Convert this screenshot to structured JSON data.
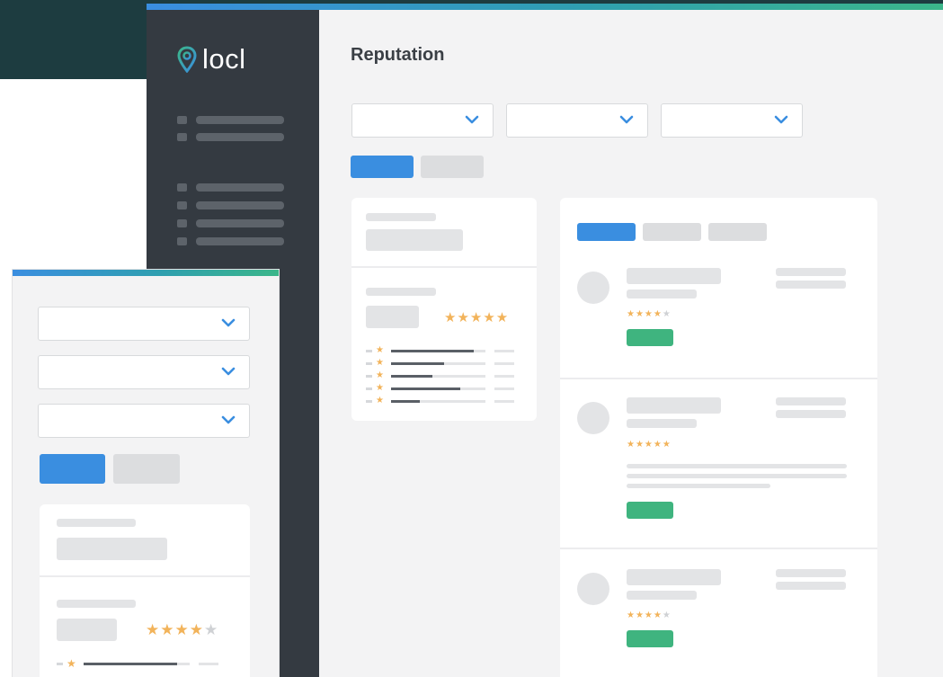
{
  "app": {
    "logo_text": "locl",
    "page_title": "Reputation"
  },
  "colors": {
    "accent_blue": "#3a8ee0",
    "accent_green": "#3fb47f",
    "sidebar": "#343a41",
    "star": "#f2b35a",
    "background_band": "#1d3c40"
  },
  "icons": {
    "logo": "map-pin-icon",
    "dropdown": "chevron-down-icon",
    "rating": "star-icon"
  },
  "desktop": {
    "filters_count": 3,
    "summary_rating_stars": "★★★★★",
    "reviews": [
      {
        "stars": "★★★★",
        "stars_off": "★",
        "rating": 4
      },
      {
        "stars": "★★★★★",
        "stars_off": "",
        "rating": 5
      },
      {
        "stars": "★★★★",
        "stars_off": "★",
        "rating": 4
      }
    ],
    "distribution_fill": [
      0.88,
      0.56,
      0.44,
      0.73,
      0.3
    ]
  },
  "mobile": {
    "summary_rating_stars": "★★★★",
    "summary_rating_off": "★",
    "summary_rating": 4
  }
}
